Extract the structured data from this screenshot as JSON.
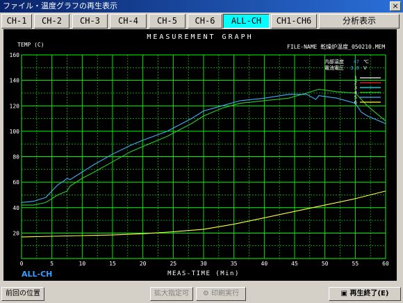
{
  "window": {
    "title": "ファイル・温度グラフの再生表示",
    "close_label": "×"
  },
  "tabs": [
    {
      "label": "CH-1"
    },
    {
      "label": "CH-2"
    },
    {
      "label": "CH-3"
    },
    {
      "label": "CH-4"
    },
    {
      "label": "CH-5"
    },
    {
      "label": "CH-6"
    },
    {
      "label": "ALL-CH",
      "active": true
    },
    {
      "label": "CH1-CH6"
    },
    {
      "label": "分析表示"
    }
  ],
  "graph": {
    "title": "MEASUREMENT GRAPH",
    "y_label": "TEMP (C)",
    "file_label": "FILE-NAME 乾燥炉温度_050210.MEM",
    "info_rows": [
      {
        "label": "内部温度",
        "value": "47",
        "unit": "℃"
      },
      {
        "label": "電池電圧",
        "value": "3.8",
        "unit": "V"
      }
    ],
    "x_label": "MEAS-TIME (Min)",
    "channel_label": "ALL-CH",
    "colors": {
      "grid": "#00ff00",
      "axis_text": "#ffffff",
      "legend_num": "#ffffff",
      "ch_label": "#3aa0ff",
      "info_value": "#3aa0ff"
    }
  },
  "chart_data": {
    "type": "line",
    "title": "MEASUREMENT GRAPH",
    "xlabel": "MEAS-TIME (Min)",
    "ylabel": "TEMP (C)",
    "xlim": [
      0,
      60
    ],
    "ylim": [
      0,
      160
    ],
    "grid": true,
    "legend": "top-right",
    "x_ticks": [
      0,
      5,
      10,
      15,
      20,
      25,
      30,
      35,
      40,
      45,
      50,
      55,
      60
    ],
    "y_ticks": [
      20,
      40,
      60,
      80,
      100,
      120,
      140,
      160
    ],
    "series": [
      {
        "name": "1",
        "color": "#ffffff",
        "x": [],
        "y": []
      },
      {
        "name": "2",
        "color": "#ff2020",
        "x": [],
        "y": []
      },
      {
        "name": "3",
        "color": "#00ffff",
        "x": [],
        "y": []
      },
      {
        "name": "4",
        "color": "#2ecc2e",
        "x": [
          0,
          2,
          4,
          6,
          7,
          7.5,
          8,
          10,
          12,
          15,
          18,
          20,
          24,
          28,
          30,
          33,
          36,
          40,
          44,
          47,
          49,
          52,
          55,
          57,
          60
        ],
        "y": [
          42,
          42,
          44,
          50,
          52,
          53,
          57,
          63,
          68,
          76,
          84,
          88,
          96,
          106,
          112,
          118,
          122,
          124,
          126,
          130,
          133,
          131,
          130,
          120,
          108
        ]
      },
      {
        "name": "5",
        "color": "#40b0ff",
        "x": [
          0,
          2,
          4,
          6,
          7,
          7.5,
          8,
          10,
          12,
          15,
          18,
          20,
          24,
          28,
          30,
          33,
          36,
          40,
          44,
          47,
          48.5,
          49,
          52,
          55,
          56,
          57,
          60
        ],
        "y": [
          44,
          45,
          48,
          58,
          61,
          63,
          62,
          68,
          74,
          82,
          89,
          93,
          100,
          110,
          116,
          120,
          124,
          126,
          129,
          129,
          125,
          128,
          126,
          122,
          115,
          112,
          106
        ]
      },
      {
        "name": "6",
        "color": "#ffff40",
        "x": [
          0,
          5,
          10,
          15,
          20,
          25,
          30,
          35,
          40,
          45,
          50,
          55,
          60
        ],
        "y": [
          17,
          17.5,
          18,
          18.5,
          19.5,
          21,
          23,
          27,
          32,
          37,
          42,
          47,
          53
        ]
      }
    ]
  },
  "status": {
    "prev_pos": "前回の位置",
    "zoom": "拡大指定可",
    "print": "印刷実行",
    "end": "再生終了(E)"
  }
}
